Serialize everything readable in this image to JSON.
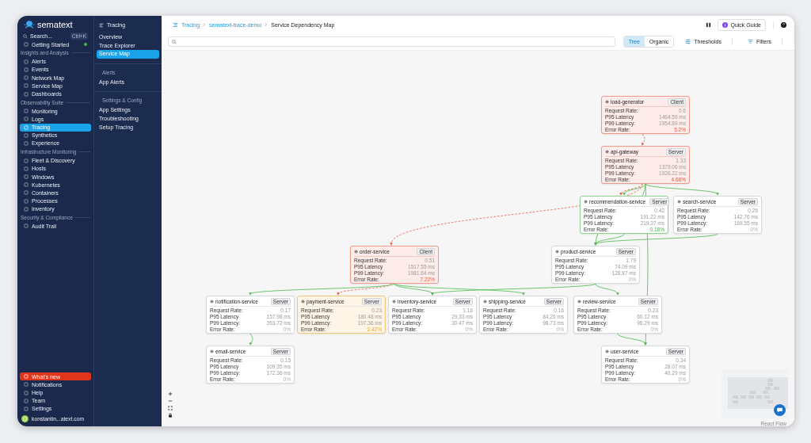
{
  "sidebar": {
    "logo": "sematext",
    "search": {
      "placeholder": "Search...",
      "shortcut": "Ctrl+K"
    },
    "top_items": [
      {
        "label": "Getting Started",
        "selected": false,
        "dot": true
      }
    ],
    "sections": [
      {
        "title": "Insights and Analysis",
        "items": [
          {
            "label": "Alerts",
            "selected": false
          },
          {
            "label": "Events",
            "selected": false
          },
          {
            "label": "Network Map",
            "selected": false
          },
          {
            "label": "Service Map",
            "selected": false
          },
          {
            "label": "Dashboards",
            "selected": false
          }
        ]
      },
      {
        "title": "Observability Suite",
        "items": [
          {
            "label": "Monitoring",
            "selected": false
          },
          {
            "label": "Logs",
            "selected": false
          },
          {
            "label": "Tracing",
            "selected": true
          },
          {
            "label": "Synthetics",
            "selected": false
          },
          {
            "label": "Experience",
            "selected": false
          }
        ]
      },
      {
        "title": "Infrastructure Monitoring",
        "items": [
          {
            "label": "Fleet & Discovery",
            "selected": false
          },
          {
            "label": "Hosts",
            "selected": false
          },
          {
            "label": "Windows",
            "selected": false
          },
          {
            "label": "Kubernetes",
            "selected": false
          },
          {
            "label": "Containers",
            "selected": false
          },
          {
            "label": "Processes",
            "selected": false
          },
          {
            "label": "Inventory",
            "selected": false
          }
        ]
      },
      {
        "title": "Security & Compliance",
        "items": [
          {
            "label": "Audit Trail",
            "selected": false
          }
        ]
      }
    ],
    "bottom_items": [
      {
        "label": "What's new",
        "kind": "highlight"
      },
      {
        "label": "Notifications",
        "kind": "plain"
      },
      {
        "label": "Help",
        "kind": "plain"
      },
      {
        "label": "Team",
        "kind": "plain"
      },
      {
        "label": "Settings",
        "kind": "plain"
      }
    ],
    "user": {
      "name": "konstantin...atext.com"
    }
  },
  "subnav": {
    "title": "Tracing",
    "items": [
      {
        "label": "Overview",
        "selected": false
      },
      {
        "label": "Trace Explorer",
        "selected": false
      },
      {
        "label": "Service Map",
        "selected": true
      }
    ],
    "groups": [
      {
        "title": "Alerts",
        "items": [
          {
            "label": "App Alerts",
            "selected": false
          }
        ]
      },
      {
        "title": "Settings & Config",
        "items": [
          {
            "label": "App Settings",
            "selected": false
          },
          {
            "label": "Troubleshooting",
            "selected": false
          },
          {
            "label": "Setup Tracing",
            "selected": false
          }
        ]
      }
    ]
  },
  "header": {
    "breadcrumb": [
      {
        "label": "Tracing",
        "link": true
      },
      {
        "label": "sematext-trace-demo",
        "link": true
      },
      {
        "label": "Service Dependency Map",
        "link": false
      }
    ],
    "quick_guide": "Quick Guide"
  },
  "toolbar": {
    "layouts": [
      {
        "label": "Tree",
        "selected": true
      },
      {
        "label": "Organic",
        "selected": false
      }
    ],
    "thresholds": "Thresholds",
    "filters": "Filters"
  },
  "map": {
    "nodes": [
      {
        "name": "load-generator",
        "type": "Client",
        "kind": "error",
        "metrics": [
          {
            "label": "Request Rate:",
            "value": "0.6"
          },
          {
            "label": "P95 Latency",
            "value": "1464.59 ms"
          },
          {
            "label": "P99 Latency:",
            "value": "1954.89 ms"
          },
          {
            "label": "Error Rate:",
            "value": "5.2%"
          }
        ]
      },
      {
        "name": "api-gateway",
        "type": "Server",
        "kind": "error",
        "metrics": [
          {
            "label": "Request Rate:",
            "value": "1.33"
          },
          {
            "label": "P95 Latency",
            "value": "1379.06 ms"
          },
          {
            "label": "P99 Latency:",
            "value": "1926.22 ms"
          },
          {
            "label": "Error Rate:",
            "value": "4.68%"
          }
        ]
      },
      {
        "name": "recommendation-service",
        "type": "Server",
        "kind": "healthy",
        "metrics": [
          {
            "label": "Request Rate:",
            "value": "0.42"
          },
          {
            "label": "P95 Latency",
            "value": "191.22 ms"
          },
          {
            "label": "P99 Latency:",
            "value": "219.37 ms"
          },
          {
            "label": "Error Rate:",
            "value": "0.18%"
          }
        ]
      },
      {
        "name": "search-service",
        "type": "Server",
        "kind": "idle",
        "metrics": [
          {
            "label": "Request Rate:",
            "value": "0.26"
          },
          {
            "label": "P95 Latency",
            "value": "142.76 ms"
          },
          {
            "label": "P99 Latency:",
            "value": "169.55 ms"
          },
          {
            "label": "Error Rate:",
            "value": "0%"
          }
        ]
      },
      {
        "name": "order-service",
        "type": "Client",
        "kind": "error",
        "metrics": [
          {
            "label": "Request Rate:",
            "value": "0.51"
          },
          {
            "label": "P95 Latency",
            "value": "1517.55 ms"
          },
          {
            "label": "P99 Latency:",
            "value": "1981.64 ms"
          },
          {
            "label": "Error Rate:",
            "value": "7.22%"
          }
        ]
      },
      {
        "name": "product-service",
        "type": "Server",
        "kind": "idle",
        "metrics": [
          {
            "label": "Request Rate:",
            "value": "1.79"
          },
          {
            "label": "P95 Latency",
            "value": "74.09 ms"
          },
          {
            "label": "P99 Latency:",
            "value": "128.87 ms"
          },
          {
            "label": "Error Rate:",
            "value": "0%"
          }
        ]
      },
      {
        "name": "notification-service",
        "type": "Server",
        "kind": "idle",
        "metrics": [
          {
            "label": "Request Rate:",
            "value": "0.17"
          },
          {
            "label": "P95 Latency",
            "value": "157.98 ms"
          },
          {
            "label": "P99 Latency:",
            "value": "263.72 ms"
          },
          {
            "label": "Error Rate:",
            "value": "0%"
          }
        ]
      },
      {
        "name": "payment-service",
        "type": "Server",
        "kind": "warning",
        "metrics": [
          {
            "label": "Request Rate:",
            "value": "0.23"
          },
          {
            "label": "P95 Latency",
            "value": "180.48 ms"
          },
          {
            "label": "P99 Latency:",
            "value": "197.36 ms"
          },
          {
            "label": "Error Rate:",
            "value": "2.42%"
          }
        ]
      },
      {
        "name": "inventory-service",
        "type": "Server",
        "kind": "idle",
        "metrics": [
          {
            "label": "Request Rate:",
            "value": "1.16"
          },
          {
            "label": "P95 Latency",
            "value": "29.33 ms"
          },
          {
            "label": "P99 Latency:",
            "value": "30.47 ms"
          },
          {
            "label": "Error Rate:",
            "value": "0%"
          }
        ]
      },
      {
        "name": "shipping-service",
        "type": "Server",
        "kind": "idle",
        "metrics": [
          {
            "label": "Request Rate:",
            "value": "0.16"
          },
          {
            "label": "P95 Latency",
            "value": "84.26 ms"
          },
          {
            "label": "P99 Latency:",
            "value": "98.73 ms"
          },
          {
            "label": "Error Rate:",
            "value": "0%"
          }
        ]
      },
      {
        "name": "review-service",
        "type": "Server",
        "kind": "idle",
        "metrics": [
          {
            "label": "Request Rate:",
            "value": "0.23"
          },
          {
            "label": "P95 Latency",
            "value": "60.12 ms"
          },
          {
            "label": "P99 Latency:",
            "value": "96.29 ms"
          },
          {
            "label": "Error Rate:",
            "value": "0%"
          }
        ]
      },
      {
        "name": "email-service",
        "type": "Server",
        "kind": "idle",
        "metrics": [
          {
            "label": "Request Rate:",
            "value": "0.15"
          },
          {
            "label": "P95 Latency",
            "value": "109.35 ms"
          },
          {
            "label": "P99 Latency:",
            "value": "172.36 ms"
          },
          {
            "label": "Error Rate:",
            "value": "0%"
          }
        ]
      },
      {
        "name": "user-service",
        "type": "Server",
        "kind": "idle",
        "metrics": [
          {
            "label": "Request Rate:",
            "value": "0.34"
          },
          {
            "label": "P95 Latency",
            "value": "28.07 ms"
          },
          {
            "label": "P99 Latency:",
            "value": "40.29 ms"
          },
          {
            "label": "Error Rate:",
            "value": "0%"
          }
        ]
      }
    ],
    "edges": [
      {
        "error": true
      },
      {
        "error": false
      },
      {
        "error": true
      },
      {
        "error": false
      },
      {
        "error": true
      },
      {
        "error": false
      },
      {
        "error": false
      },
      {
        "error": false
      },
      {
        "error": false
      },
      {
        "error": false
      },
      {
        "error": true
      },
      {
        "error": false
      },
      {
        "error": false
      },
      {
        "error": false
      },
      {
        "error": false
      },
      {
        "error": false
      },
      {
        "error": false
      }
    ],
    "attribution": "React Flow"
  }
}
